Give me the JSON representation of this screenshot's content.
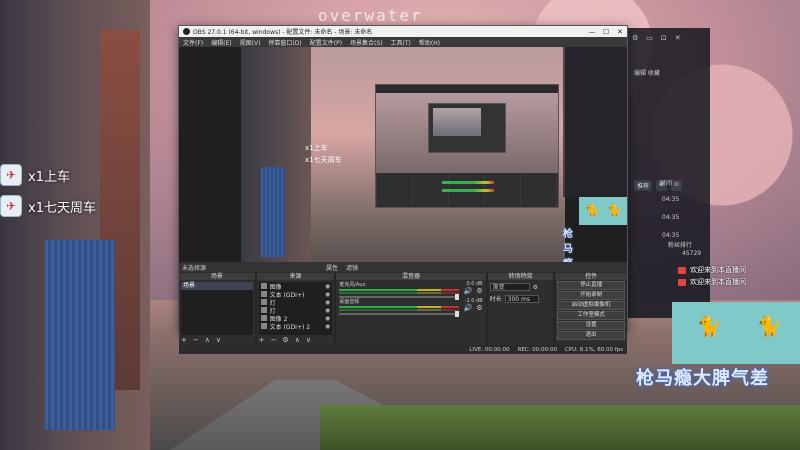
{
  "watermark": "overwater",
  "gifts": [
    {
      "icon": "✈",
      "text": "x1上车"
    },
    {
      "icon": "✈",
      "text": "x1七天周车"
    }
  ],
  "obs": {
    "title": "OBS 27.0.1 (64-bit, windows) - 配置文件: 未命名 - 场景: 未命名",
    "menu": [
      "文件(F)",
      "编辑(E)",
      "视图(V)",
      "停靠窗口(D)",
      "配置文件(P)",
      "场景集合(S)",
      "工具(T)",
      "帮助(H)"
    ],
    "window_buttons": [
      "—",
      "☐",
      "✕"
    ],
    "source_bar": {
      "label": "未选择源",
      "opt1": "属性",
      "opt2": "滤镜"
    },
    "docks": {
      "scenes": {
        "title": "场景",
        "items": [
          "场景"
        ]
      },
      "sources": {
        "title": "来源",
        "items": [
          "图像",
          "文本 (GDI+)",
          "灯",
          "灯",
          "图像 2",
          "文本 (GDI+) 2"
        ]
      },
      "mixer": {
        "title": "混音器",
        "tracks": [
          {
            "name": "麦克风/Aux",
            "db": "0.0 dB"
          },
          {
            "name": "桌面音频",
            "db": "-1.0 dB"
          }
        ]
      },
      "transitions": {
        "title": "转场特效",
        "type_label": "渐变",
        "duration_label": "时长",
        "duration": "300 ms"
      },
      "controls": {
        "title": "控件",
        "buttons": [
          "停止直播",
          "开始录制",
          "启动虚拟摄像机",
          "工作室模式",
          "设置",
          "退出"
        ]
      }
    },
    "status": {
      "live": "LIVE: 00:00:00",
      "rec": "REC: 00:00:00",
      "cpu": "CPU: 8.1%, 60.00 fps"
    }
  },
  "preview": {
    "gifts": [
      "x1上车",
      "x1七天周车"
    ],
    "caption": "枪马瘾大脾气差"
  },
  "chat": {
    "top_icons": [
      "⚙",
      "▭",
      "⊡",
      "✕"
    ],
    "row1": "编辑  收藏",
    "tabs": [
      "推荐",
      "⊕",
      "⊙"
    ],
    "rows": [
      "时间",
      "04:35",
      "04:35",
      "04:35",
      "粉丝排行",
      "45729"
    ],
    "messages": [
      "欢迎来到本直播间",
      "欢迎来到本直播间"
    ]
  },
  "overlay": {
    "caption": "枪马瘾大脾气差",
    "cat_glyph": "🐈"
  }
}
